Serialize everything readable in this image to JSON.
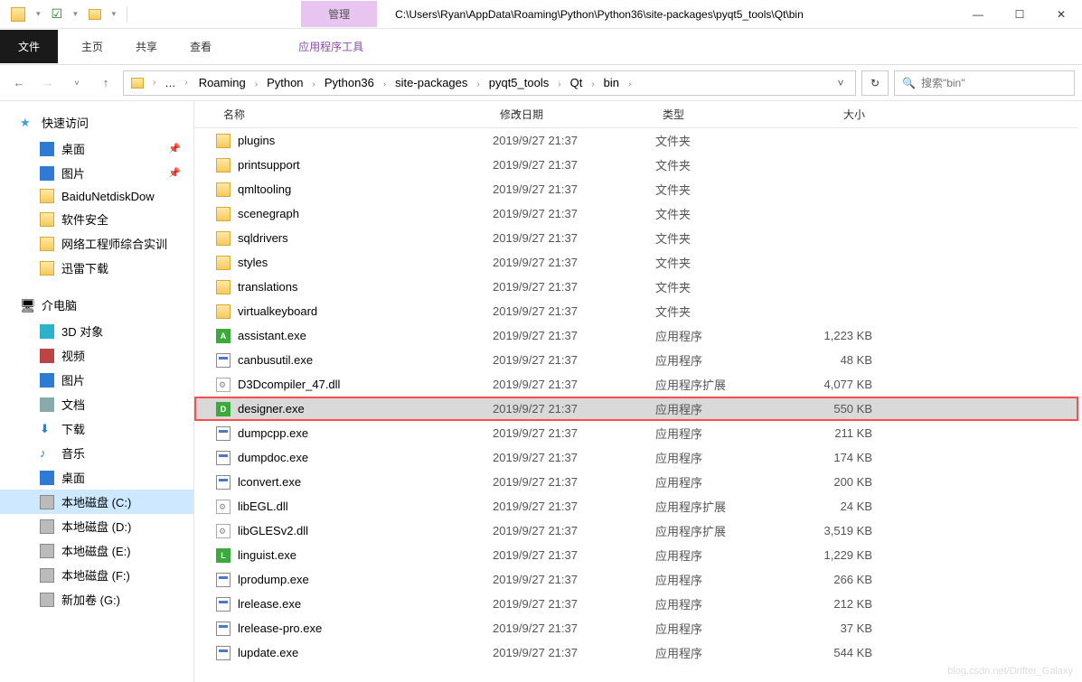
{
  "title_path": "C:\\Users\\Ryan\\AppData\\Roaming\\Python\\Python36\\site-packages\\pyqt5_tools\\Qt\\bin",
  "manage_tab": "管理",
  "ribbon": {
    "file": "文件",
    "home": "主页",
    "share": "共享",
    "view": "查看",
    "app_tools": "应用程序工具"
  },
  "breadcrumbs": [
    "Roaming",
    "Python",
    "Python36",
    "site-packages",
    "pyqt5_tools",
    "Qt",
    "bin"
  ],
  "search_placeholder": "搜索\"bin\"",
  "columns": {
    "name": "名称",
    "date": "修改日期",
    "type": "类型",
    "size": "大小"
  },
  "sidebar": {
    "quick": {
      "label": "快速访问",
      "items": [
        {
          "label": "桌面",
          "icon": "ico-desktop",
          "pin": true
        },
        {
          "label": "图片",
          "icon": "ico-pic",
          "pin": true
        },
        {
          "label": "BaiduNetdiskDow",
          "icon": "ico-folder"
        },
        {
          "label": "软件安全",
          "icon": "ico-folder"
        },
        {
          "label": "网络工程师综合实训",
          "icon": "ico-folder"
        },
        {
          "label": "迅雷下载",
          "icon": "ico-folder"
        }
      ]
    },
    "pc": {
      "label": "介电脑",
      "items": [
        {
          "label": "3D 对象",
          "icon": "ico-3d"
        },
        {
          "label": "视频",
          "icon": "ico-video"
        },
        {
          "label": "图片",
          "icon": "ico-pic"
        },
        {
          "label": "文档",
          "icon": "ico-doc"
        },
        {
          "label": "下载",
          "icon": "ico-down"
        },
        {
          "label": "音乐",
          "icon": "ico-music"
        },
        {
          "label": "桌面",
          "icon": "ico-desktop"
        },
        {
          "label": "本地磁盘 (C:)",
          "icon": "ico-disk",
          "selected": true
        },
        {
          "label": "本地磁盘 (D:)",
          "icon": "ico-disk"
        },
        {
          "label": "本地磁盘 (E:)",
          "icon": "ico-disk"
        },
        {
          "label": "本地磁盘 (F:)",
          "icon": "ico-disk"
        },
        {
          "label": "新加卷 (G:)",
          "icon": "ico-disk"
        }
      ]
    }
  },
  "type_labels": {
    "folder": "文件夹",
    "exe": "应用程序",
    "dll": "应用程序扩展"
  },
  "rows": [
    {
      "name": "plugins",
      "date": "2019/9/27 21:37",
      "type": "folder",
      "icon": "fi-folder"
    },
    {
      "name": "printsupport",
      "date": "2019/9/27 21:37",
      "type": "folder",
      "icon": "fi-folder"
    },
    {
      "name": "qmltooling",
      "date": "2019/9/27 21:37",
      "type": "folder",
      "icon": "fi-folder"
    },
    {
      "name": "scenegraph",
      "date": "2019/9/27 21:37",
      "type": "folder",
      "icon": "fi-folder"
    },
    {
      "name": "sqldrivers",
      "date": "2019/9/27 21:37",
      "type": "folder",
      "icon": "fi-folder"
    },
    {
      "name": "styles",
      "date": "2019/9/27 21:37",
      "type": "folder",
      "icon": "fi-folder"
    },
    {
      "name": "translations",
      "date": "2019/9/27 21:37",
      "type": "folder",
      "icon": "fi-folder"
    },
    {
      "name": "virtualkeyboard",
      "date": "2019/9/27 21:37",
      "type": "folder",
      "icon": "fi-folder"
    },
    {
      "name": "assistant.exe",
      "date": "2019/9/27 21:37",
      "type": "exe",
      "size": "1,223 KB",
      "icon": "fi-green",
      "letter": "A"
    },
    {
      "name": "canbusutil.exe",
      "date": "2019/9/27 21:37",
      "type": "exe",
      "size": "48 KB",
      "icon": "fi-exe"
    },
    {
      "name": "D3Dcompiler_47.dll",
      "date": "2019/9/27 21:37",
      "type": "dll",
      "size": "4,077 KB",
      "icon": "fi-dll"
    },
    {
      "name": "designer.exe",
      "date": "2019/9/27 21:37",
      "type": "exe",
      "size": "550 KB",
      "icon": "fi-green",
      "letter": "D",
      "selected": true,
      "highlight": true
    },
    {
      "name": "dumpcpp.exe",
      "date": "2019/9/27 21:37",
      "type": "exe",
      "size": "211 KB",
      "icon": "fi-exe"
    },
    {
      "name": "dumpdoc.exe",
      "date": "2019/9/27 21:37",
      "type": "exe",
      "size": "174 KB",
      "icon": "fi-exe"
    },
    {
      "name": "lconvert.exe",
      "date": "2019/9/27 21:37",
      "type": "exe",
      "size": "200 KB",
      "icon": "fi-exe"
    },
    {
      "name": "libEGL.dll",
      "date": "2019/9/27 21:37",
      "type": "dll",
      "size": "24 KB",
      "icon": "fi-dll"
    },
    {
      "name": "libGLESv2.dll",
      "date": "2019/9/27 21:37",
      "type": "dll",
      "size": "3,519 KB",
      "icon": "fi-dll"
    },
    {
      "name": "linguist.exe",
      "date": "2019/9/27 21:37",
      "type": "exe",
      "size": "1,229 KB",
      "icon": "fi-green",
      "letter": "L"
    },
    {
      "name": "lprodump.exe",
      "date": "2019/9/27 21:37",
      "type": "exe",
      "size": "266 KB",
      "icon": "fi-exe"
    },
    {
      "name": "lrelease.exe",
      "date": "2019/9/27 21:37",
      "type": "exe",
      "size": "212 KB",
      "icon": "fi-exe"
    },
    {
      "name": "lrelease-pro.exe",
      "date": "2019/9/27 21:37",
      "type": "exe",
      "size": "37 KB",
      "icon": "fi-exe"
    },
    {
      "name": "lupdate.exe",
      "date": "2019/9/27 21:37",
      "type": "exe",
      "size": "544 KB",
      "icon": "fi-exe"
    }
  ],
  "watermark": "blog.csdn.net/Drifter_Galaxy"
}
